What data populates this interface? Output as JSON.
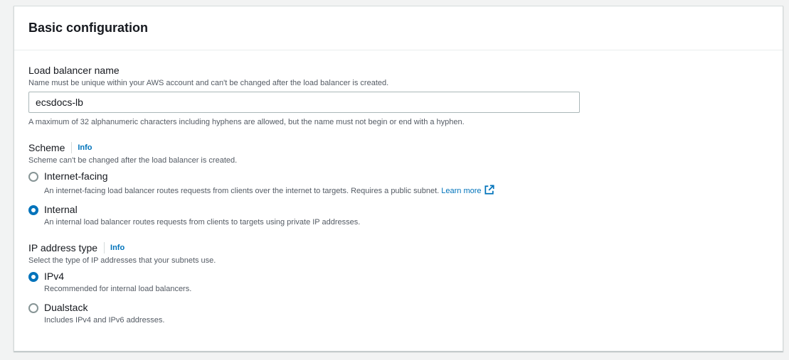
{
  "panel": {
    "title": "Basic configuration"
  },
  "name_field": {
    "label": "Load balancer name",
    "description": "Name must be unique within your AWS account and can't be changed after the load balancer is created.",
    "value": "ecsdocs-lb",
    "constraint": "A maximum of 32 alphanumeric characters including hyphens are allowed, but the name must not begin or end with a hyphen."
  },
  "scheme": {
    "label": "Scheme",
    "info": "Info",
    "description": "Scheme can't be changed after the load balancer is created.",
    "options": [
      {
        "label": "Internet-facing",
        "description": "An internet-facing load balancer routes requests from clients over the internet to targets. Requires a public subnet.",
        "link": "Learn more",
        "selected": false
      },
      {
        "label": "Internal",
        "description": "An internal load balancer routes requests from clients to targets using private IP addresses.",
        "selected": true
      }
    ]
  },
  "ip_type": {
    "label": "IP address type",
    "info": "Info",
    "description": "Select the type of IP addresses that your subnets use.",
    "options": [
      {
        "label": "IPv4",
        "description": "Recommended for internal load balancers.",
        "selected": true
      },
      {
        "label": "Dualstack",
        "description": "Includes IPv4 and IPv6 addresses.",
        "selected": false
      }
    ]
  },
  "colors": {
    "accent": "#0073bb",
    "text": "#16191f",
    "muted": "#545b64"
  },
  "icons": {
    "external_link": "external-link-icon"
  }
}
